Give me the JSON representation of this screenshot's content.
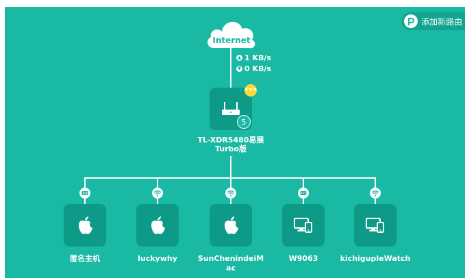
{
  "add_router": {
    "label": "添加新路由",
    "logo": "p"
  },
  "internet": {
    "label": "Internet"
  },
  "speed": {
    "upload": "1 KB/s",
    "download": "0 KB/s"
  },
  "router": {
    "name_line1": "TL-XDR5480易展",
    "name_line2": "Turbo版",
    "count": "5",
    "more": "•••"
  },
  "devices": [
    {
      "name": "匿名主机",
      "name2": "",
      "connection": "wired-icon",
      "device_icon": "apple-icon"
    },
    {
      "name": "luckywhy",
      "name2": "",
      "connection": "wifi-icon",
      "device_icon": "apple-icon"
    },
    {
      "name": "SunChenindeiM",
      "name2": "ac",
      "connection": "wifi-icon",
      "device_icon": "apple-icon"
    },
    {
      "name": "W9063",
      "name2": "",
      "connection": "wired-icon",
      "device_icon": "computer-phone-icon"
    },
    {
      "name": "kichigupleWatch",
      "name2": "",
      "connection": "wifi-icon",
      "device_icon": "computer-phone-icon"
    }
  ],
  "colors": {
    "background": "#1ab9a3",
    "tile": "#0d9b87",
    "badge": "#ffd83a"
  }
}
